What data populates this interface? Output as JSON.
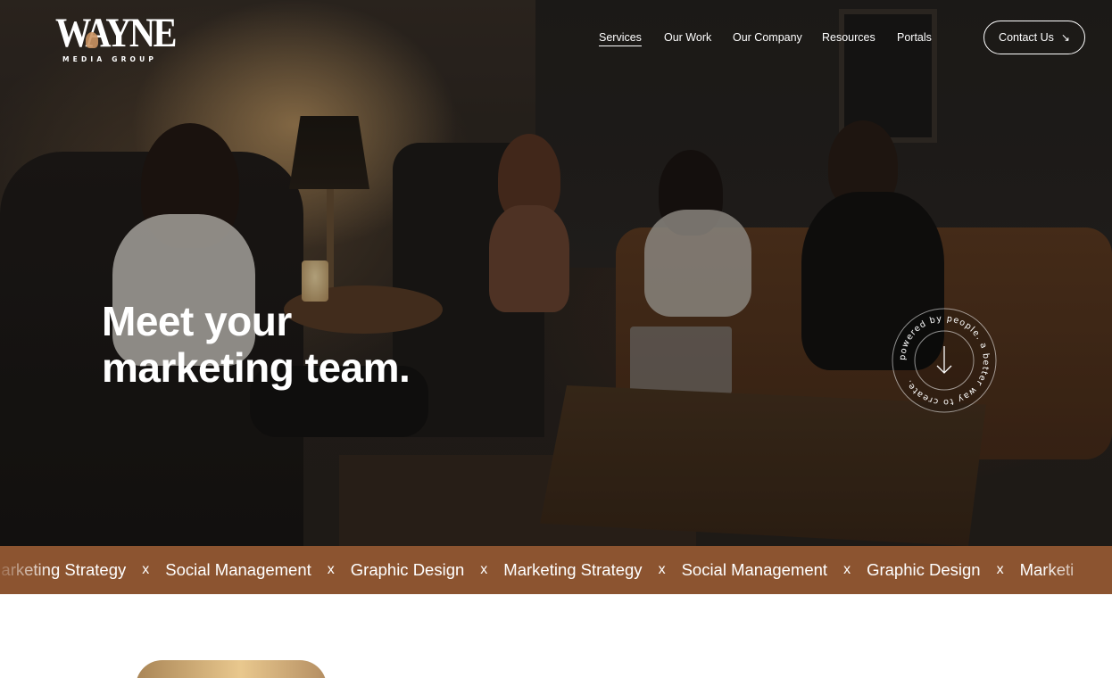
{
  "brand": {
    "name": "WAYNE",
    "sub": "MEDIA GROUP"
  },
  "nav": {
    "items": [
      "Services",
      "Our Work",
      "Our Company",
      "Resources",
      "Portals"
    ],
    "active": "Services"
  },
  "contact": {
    "label": "Contact Us",
    "icon": "arrow-down-right-icon"
  },
  "hero": {
    "title_line1": "Meet your",
    "title_line2": "marketing team."
  },
  "badge": {
    "text": "powered by people. a better way to create.",
    "icon": "arrow-down-icon"
  },
  "marquee": {
    "items": [
      "Marketing Strategy",
      "Social Management",
      "Graphic Design",
      "Marketing Strategy",
      "Social Management",
      "Graphic Design",
      "Marketi"
    ],
    "separator": "x"
  },
  "colors": {
    "accent": "#8c5430",
    "text_light": "#ffffff"
  }
}
